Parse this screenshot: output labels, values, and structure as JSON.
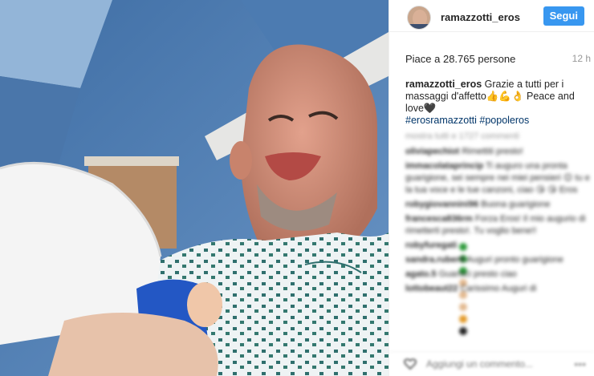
{
  "post": {
    "username": "ramazzotti_eros",
    "follow_label": "Segui",
    "likes_text": "Piace a 28.765 persone",
    "time_ago": "12 h",
    "caption": {
      "username": "ramazzotti_eros",
      "text": " Grazie a tutti per i massaggi d'affetto👍💪👌 Peace and love🖤",
      "hashtags": "#erosramazzotti #popoleros"
    }
  },
  "comments": {
    "load_more": "mostra tutti e 1727 commenti",
    "items": [
      {
        "user": "oliviapechiot",
        "text": "Rimettiti presto!"
      },
      {
        "user": "immacolataprincip",
        "text": "Ti auguro una pronta guarigione, sei sempre nei miei pensieri 😊 tu e la tua voce e le tue canzoni, ciao 😘 😘 Eros"
      },
      {
        "user": "robygiovannini96",
        "text": "Buona guarigione"
      },
      {
        "user": "francesca836rm",
        "text": "Forza Eros! Il mio augurio di rimetterti presto!. Tu voglio bene!!"
      },
      {
        "user": "robyfuregati",
        "text": ""
      },
      {
        "user": "sandra.ruberti",
        "text": "Auguri pronto guarigione"
      },
      {
        "user": "agato.5",
        "text": "Guarisci presto ciao"
      },
      {
        "user": "lottobeaut22",
        "text": "Carissimo Auguri di"
      }
    ]
  },
  "add_comment": {
    "placeholder": "Aggiungi un commento..."
  },
  "colors": {
    "accent": "#3897f0",
    "hashtag": "#003569",
    "muted": "#999999"
  }
}
